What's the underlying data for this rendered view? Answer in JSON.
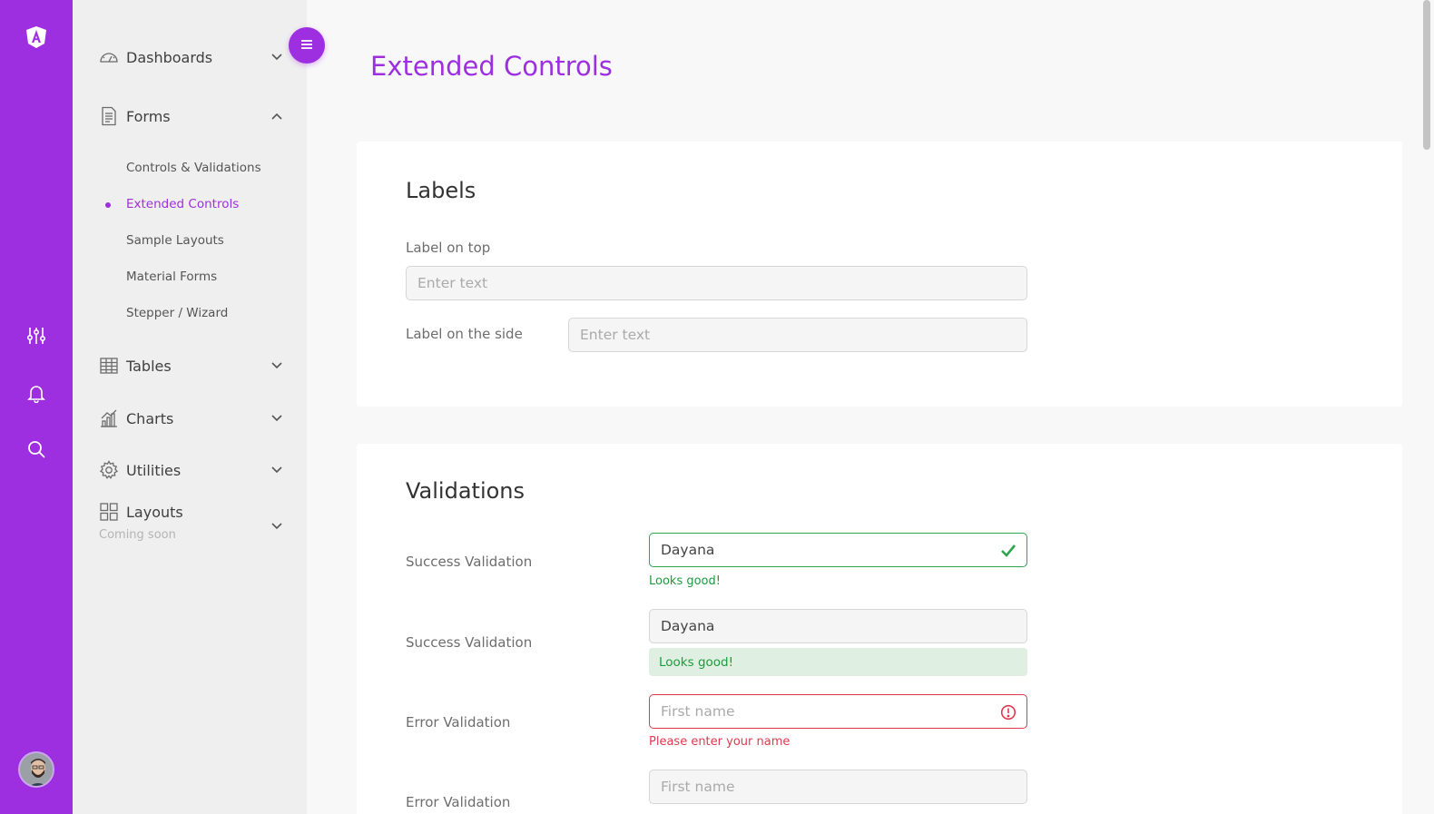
{
  "sidebar": {
    "items": [
      {
        "label": "Dashboards",
        "icon": "gauge-icon"
      },
      {
        "label": "Forms",
        "icon": "document-icon"
      },
      {
        "label": "Tables",
        "icon": "table-icon"
      },
      {
        "label": "Charts",
        "icon": "bar-chart-icon"
      },
      {
        "label": "Utilities",
        "icon": "gear-icon"
      },
      {
        "label": "Layouts",
        "icon": "grid-icon",
        "caption": "Coming soon"
      }
    ],
    "forms_sub": [
      {
        "label": "Controls & Validations"
      },
      {
        "label": "Extended Controls",
        "active": true
      },
      {
        "label": "Sample Layouts"
      },
      {
        "label": "Material Forms"
      },
      {
        "label": "Stepper / Wizard"
      }
    ]
  },
  "page": {
    "title": "Extended Controls"
  },
  "labels_card": {
    "title": "Labels",
    "top_label": "Label on top",
    "top_placeholder": "Enter text",
    "side_label": "Label on the side",
    "side_placeholder": "Enter text"
  },
  "validations_card": {
    "title": "Validations",
    "rows": [
      {
        "label": "Success Validation",
        "value": "Dayana",
        "message": "Looks good!"
      },
      {
        "label": "Success Validation",
        "value": "Dayana",
        "message": "Looks good!"
      },
      {
        "label": "Error Validation",
        "placeholder": "First name",
        "message": "Please enter your name"
      },
      {
        "label": "Error Validation",
        "placeholder": "First name"
      }
    ]
  },
  "colors": {
    "accent": "#9d2fe0",
    "success": "#2ea44f",
    "error": "#e0394f"
  }
}
